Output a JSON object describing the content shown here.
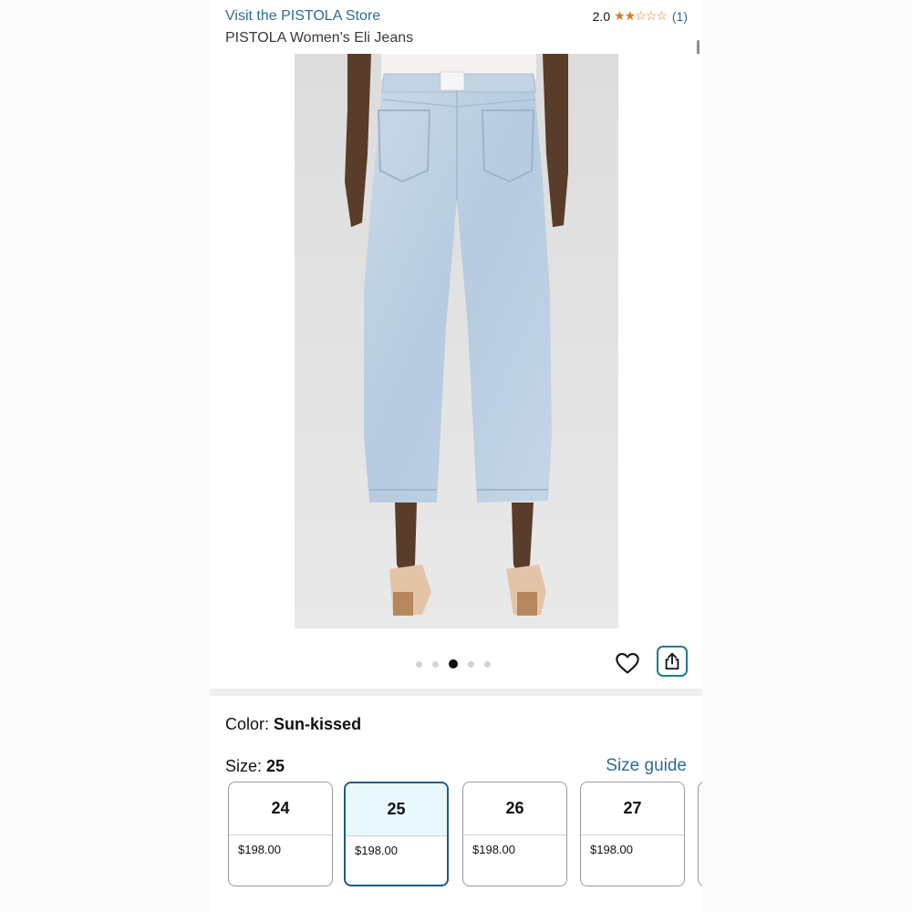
{
  "header": {
    "store_link": "Visit the PISTOLA Store",
    "product_title": "PISTOLA Women's Eli Jeans",
    "rating_value": "2.0",
    "stars": "★★☆☆☆",
    "rating_count": "(1)"
  },
  "carousel": {
    "image_count": 5,
    "active_index": 2
  },
  "color": {
    "label": "Color:",
    "value": "Sun-kissed"
  },
  "size": {
    "label": "Size:",
    "value": "25",
    "guide_link": "Size guide",
    "options": [
      {
        "size": "24",
        "price": "$198.00",
        "selected": false
      },
      {
        "size": "25",
        "price": "$198.00",
        "selected": true
      },
      {
        "size": "26",
        "price": "$198.00",
        "selected": false
      },
      {
        "size": "27",
        "price": "$198.00",
        "selected": false
      }
    ]
  },
  "icons": {
    "wishlist": "heart-icon",
    "share": "share-icon"
  },
  "colors": {
    "link": "#2f6b94",
    "star": "#de7921",
    "share_border": "#1a7c8c",
    "selected_border": "#1d5a8a",
    "selected_fill": "#e9f8fc"
  }
}
